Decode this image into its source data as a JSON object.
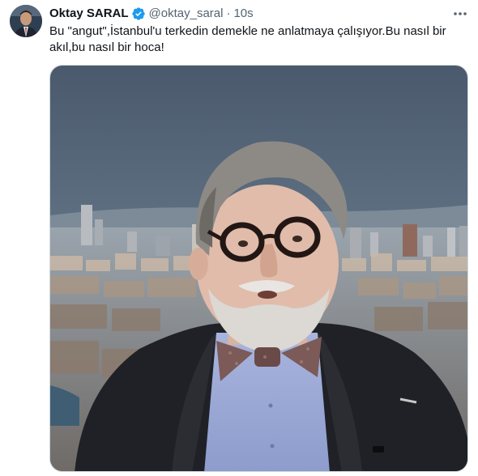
{
  "tweet": {
    "author": {
      "display_name": "Oktay SARAL",
      "handle": "@oktay_saral",
      "verified": true,
      "avatar_icon": "profile-photo"
    },
    "separator": "·",
    "timestamp": "10s",
    "more_icon": "more-horizontal-icon",
    "text": "Bu \"angut\",İstanbul'u terkedin demekle ne anlatmaya çalışıyor.Bu nasıl bir akıl,bu nasıl bir hoca!",
    "media": {
      "type": "photo"
    }
  },
  "colors": {
    "verified_badge": "#1d9bf0",
    "secondary_text": "#536471",
    "primary_text": "#0f1419"
  }
}
